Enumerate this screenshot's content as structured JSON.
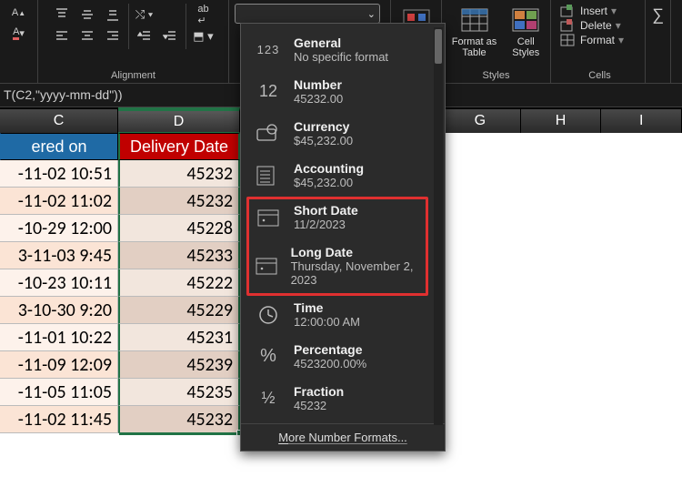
{
  "ribbon": {
    "group_alignment_label": "Alignment",
    "group_styles_label": "Styles",
    "group_cells_label": "Cells",
    "format_as_table": "Format as\nTable",
    "cell_styles": "Cell\nStyles",
    "cells_insert": "Insert",
    "cells_delete": "Delete",
    "cells_format": "Format"
  },
  "formula": "T(C2,\"yyyy-mm-dd\"))",
  "columns": {
    "c": "C",
    "d": "D",
    "g": "G",
    "h": "H",
    "i": "I"
  },
  "headers": {
    "c": "ered on",
    "d": "Delivery Date"
  },
  "rows": [
    {
      "c": "-11-02 10:51",
      "d": "45232"
    },
    {
      "c": "-11-02 11:02",
      "d": "45232"
    },
    {
      "c": "-10-29 12:00",
      "d": "45228"
    },
    {
      "c": "3-11-03 9:45",
      "d": "45233"
    },
    {
      "c": "-10-23 10:11",
      "d": "45222"
    },
    {
      "c": "3-10-30 9:20",
      "d": "45229"
    },
    {
      "c": "-11-01 10:22",
      "d": "45231"
    },
    {
      "c": "-11-09 12:09",
      "d": "45239"
    },
    {
      "c": "-11-05 11:05",
      "d": "45235"
    },
    {
      "c": "-11-02 11:45",
      "d": "45232"
    }
  ],
  "number_formats": [
    {
      "key": "general",
      "title": "General",
      "sample": "No specific format"
    },
    {
      "key": "number",
      "title": "Number",
      "sample": "45232.00"
    },
    {
      "key": "currency",
      "title": "Currency",
      "sample": "$45,232.00"
    },
    {
      "key": "accounting",
      "title": "Accounting",
      "sample": "$45,232.00"
    },
    {
      "key": "shortdate",
      "title": "Short Date",
      "sample": "11/2/2023"
    },
    {
      "key": "longdate",
      "title": "Long Date",
      "sample": "Thursday, November 2, 2023"
    },
    {
      "key": "time",
      "title": "Time",
      "sample": "12:00:00 AM"
    },
    {
      "key": "percentage",
      "title": "Percentage",
      "sample": "4523200.00%"
    },
    {
      "key": "fraction",
      "title": "Fraction",
      "sample": "45232"
    }
  ],
  "more_formats_label": "More Number Formats...",
  "highlight_range": {
    "start_index": 4,
    "end_index": 5
  }
}
